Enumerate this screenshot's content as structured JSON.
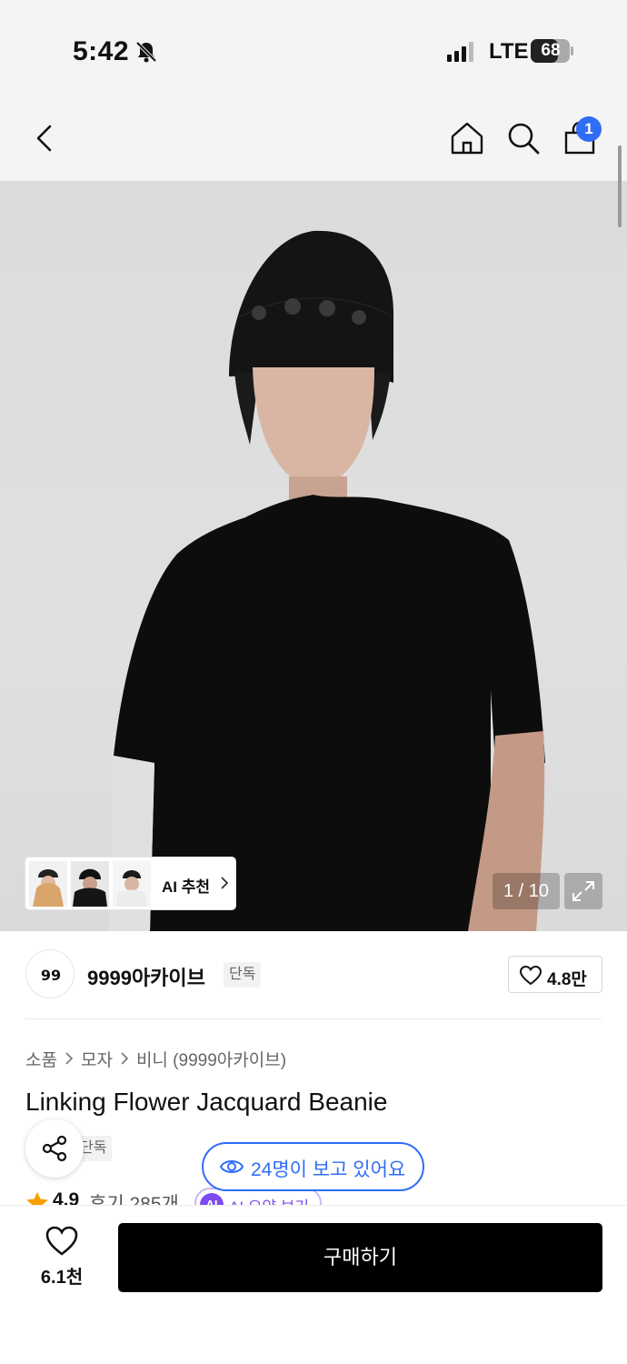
{
  "status_bar": {
    "time": "5:42",
    "network": "LTE",
    "battery": "68"
  },
  "header": {
    "cart_count": "1"
  },
  "hero": {
    "ai_rec_label": "AI 추천",
    "page_counter": "1 / 10"
  },
  "brand": {
    "name": "9999아카이브",
    "tag": "단독",
    "likes": "4.8만"
  },
  "breadcrumb": [
    "소품",
    "모자",
    "비니 (9999아카이브)"
  ],
  "product": {
    "title": "Linking Flower Jacquard Beanie",
    "exclusive_tag": "단독",
    "viewers": "24명이 보고 있어요",
    "rating": "4.9",
    "reviews": "후기 285개",
    "ai_chip_badge": "AI",
    "ai_chip_text": "AI 요약 보기"
  },
  "bottom_bar": {
    "wish_count": "6.1천",
    "buy_label": "구매하기"
  },
  "colors": {
    "accent_blue": "#2f6df6",
    "ai_purple": "#7d4bf0",
    "buy_button": "#000000"
  }
}
